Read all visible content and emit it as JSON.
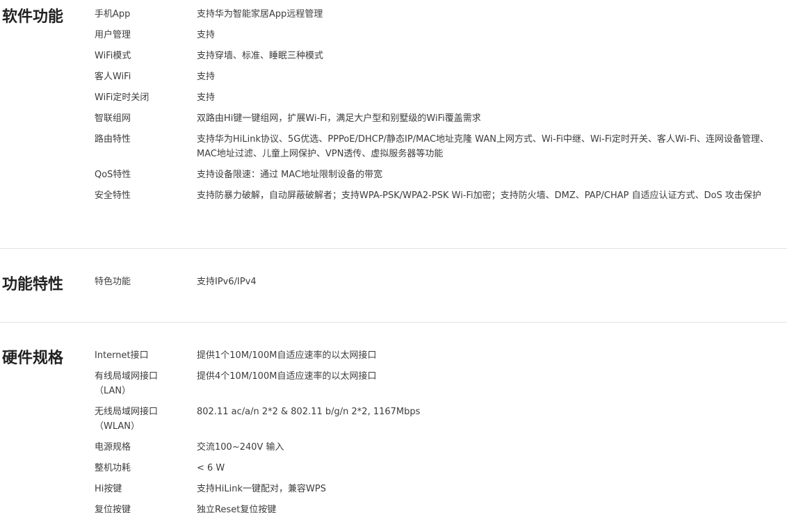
{
  "sections": [
    {
      "title": "软件功能",
      "rows": [
        {
          "label": "手机App",
          "value": "支持华为智能家居App远程管理"
        },
        {
          "label": "用户管理",
          "value": "支持"
        },
        {
          "label": "WiFi模式",
          "value": "支持穿墙、标准、睡眠三种模式"
        },
        {
          "label": "客人WiFi",
          "value": "支持"
        },
        {
          "label": "WiFi定时关闭",
          "value": "支持"
        },
        {
          "label": "智联组网",
          "value": "双路由Hi键一键组网，扩展Wi-Fi，满足大户型和别墅级的WiFi覆盖需求"
        },
        {
          "label": "路由特性",
          "value": "支持华为HiLink协议、5G优选、PPPoE/DHCP/静态IP/MAC地址克隆 WAN上网方式、Wi-Fi中继、Wi-Fi定时开关、客人Wi-Fi、连网设备管理、MAC地址过滤、儿童上网保护、VPN透传、虚拟服务器等功能"
        },
        {
          "label": "QoS特性",
          "value": "支持设备限速：通过 MAC地址限制设备的带宽"
        },
        {
          "label": "安全特性",
          "value": "支持防暴力破解，自动屏蔽破解者；支持WPA-PSK/WPA2-PSK Wi-Fi加密；支持防火墙、DMZ、PAP/CHAP 自适应认证方式、DoS 攻击保护"
        }
      ]
    },
    {
      "title": "功能特性",
      "rows": [
        {
          "label": "特色功能",
          "value": "支持IPv6/IPv4"
        }
      ]
    },
    {
      "title": "硬件规格",
      "rows": [
        {
          "label": "Internet接口",
          "value": "提供1个10M/100M自适应速率的以太网接口"
        },
        {
          "label": "有线局域网接口",
          "label2": "（LAN）",
          "value": "提供4个10M/100M自适应速率的以太网接口"
        },
        {
          "label": "无线局域网接口",
          "label2": "（WLAN）",
          "value": "802.11 ac/a/n 2*2 & 802.11 b/g/n 2*2, 1167Mbps"
        },
        {
          "label": "电源规格",
          "value": "交流100~240V 输入"
        },
        {
          "label": "整机功耗",
          "value": "< 6 W"
        },
        {
          "label": "Hi按键",
          "value": "支持HiLink一键配对，兼容WPS"
        },
        {
          "label": "复位按键",
          "value": "独立Reset复位按键"
        }
      ]
    }
  ]
}
